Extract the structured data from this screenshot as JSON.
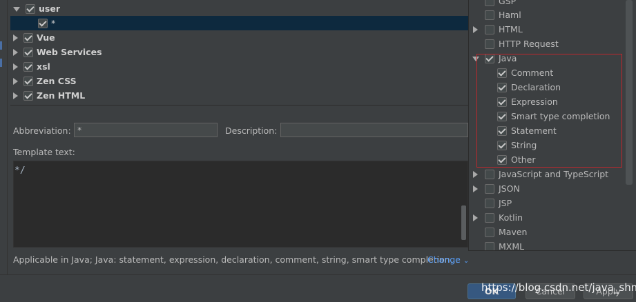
{
  "tree": {
    "items": [
      {
        "label": "user",
        "expanded": true,
        "checked": true
      },
      {
        "label": "*",
        "checked": true,
        "selected": true
      },
      {
        "label": "Vue",
        "expanded": false,
        "checked": true
      },
      {
        "label": "Web Services",
        "expanded": false,
        "checked": true
      },
      {
        "label": "xsl",
        "expanded": false,
        "checked": true
      },
      {
        "label": "Zen CSS",
        "expanded": false,
        "checked": true
      },
      {
        "label": "Zen HTML",
        "expanded": false,
        "checked": true
      }
    ]
  },
  "form": {
    "abbreviation_label": "Abbreviation:",
    "abbreviation_value": "*",
    "description_label": "Description:",
    "description_value": "",
    "template_text_label": "Template text:",
    "template_text_value": "*/"
  },
  "applicable": {
    "text": "Applicable in Java; Java: statement, expression, declaration, comment, string, smart type completion...",
    "change_label": "Change",
    "change_icon": "chevron-down-icon"
  },
  "buttons": {
    "ok": "OK",
    "cancel": "Cancel",
    "apply": "Apply"
  },
  "watermark": "https://blog.csdn.net/java_shm",
  "contexts": {
    "items": [
      {
        "label": "GSP",
        "checked": false,
        "expandable": false
      },
      {
        "label": "Haml",
        "checked": false,
        "expandable": false
      },
      {
        "label": "HTML",
        "checked": false,
        "expandable": true
      },
      {
        "label": "HTTP Request",
        "checked": false,
        "expandable": false
      },
      {
        "label": "Java",
        "checked": true,
        "expandable": true,
        "expanded": true
      },
      {
        "label": "Comment",
        "checked": true,
        "child": true
      },
      {
        "label": "Declaration",
        "checked": true,
        "child": true
      },
      {
        "label": "Expression",
        "checked": true,
        "child": true
      },
      {
        "label": "Smart type completion",
        "checked": true,
        "child": true
      },
      {
        "label": "Statement",
        "checked": true,
        "child": true
      },
      {
        "label": "String",
        "checked": true,
        "child": true
      },
      {
        "label": "Other",
        "checked": true,
        "child": true
      },
      {
        "label": "JavaScript and TypeScript",
        "checked": false,
        "expandable": true
      },
      {
        "label": "JSON",
        "checked": false,
        "expandable": true
      },
      {
        "label": "JSP",
        "checked": false,
        "expandable": false
      },
      {
        "label": "Kotlin",
        "checked": false,
        "expandable": true
      },
      {
        "label": "Maven",
        "checked": false,
        "expandable": false
      },
      {
        "label": "MXML",
        "checked": false,
        "expandable": false
      }
    ]
  },
  "colors": {
    "highlight_box": "#c0282d",
    "selection": "#0d293e",
    "link": "#589df6"
  }
}
